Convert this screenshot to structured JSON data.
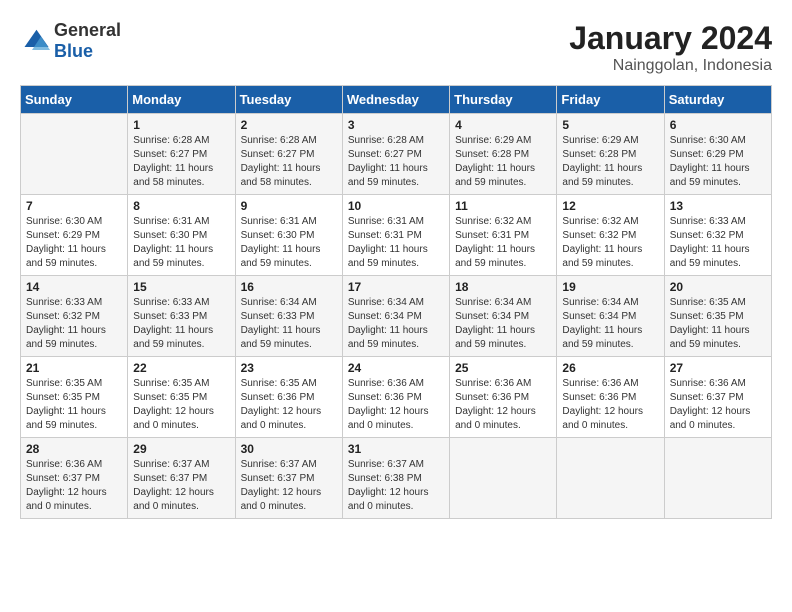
{
  "header": {
    "logo_general": "General",
    "logo_blue": "Blue",
    "month_year": "January 2024",
    "location": "Nainggolan, Indonesia"
  },
  "days_of_week": [
    "Sunday",
    "Monday",
    "Tuesday",
    "Wednesday",
    "Thursday",
    "Friday",
    "Saturday"
  ],
  "weeks": [
    [
      {
        "day": "",
        "sunrise": "",
        "sunset": "",
        "daylight": ""
      },
      {
        "day": "1",
        "sunrise": "6:28 AM",
        "sunset": "6:27 PM",
        "daylight": "11 hours and 58 minutes."
      },
      {
        "day": "2",
        "sunrise": "6:28 AM",
        "sunset": "6:27 PM",
        "daylight": "11 hours and 58 minutes."
      },
      {
        "day": "3",
        "sunrise": "6:28 AM",
        "sunset": "6:27 PM",
        "daylight": "11 hours and 59 minutes."
      },
      {
        "day": "4",
        "sunrise": "6:29 AM",
        "sunset": "6:28 PM",
        "daylight": "11 hours and 59 minutes."
      },
      {
        "day": "5",
        "sunrise": "6:29 AM",
        "sunset": "6:28 PM",
        "daylight": "11 hours and 59 minutes."
      },
      {
        "day": "6",
        "sunrise": "6:30 AM",
        "sunset": "6:29 PM",
        "daylight": "11 hours and 59 minutes."
      }
    ],
    [
      {
        "day": "7",
        "sunrise": "6:30 AM",
        "sunset": "6:29 PM",
        "daylight": "11 hours and 59 minutes."
      },
      {
        "day": "8",
        "sunrise": "6:31 AM",
        "sunset": "6:30 PM",
        "daylight": "11 hours and 59 minutes."
      },
      {
        "day": "9",
        "sunrise": "6:31 AM",
        "sunset": "6:30 PM",
        "daylight": "11 hours and 59 minutes."
      },
      {
        "day": "10",
        "sunrise": "6:31 AM",
        "sunset": "6:31 PM",
        "daylight": "11 hours and 59 minutes."
      },
      {
        "day": "11",
        "sunrise": "6:32 AM",
        "sunset": "6:31 PM",
        "daylight": "11 hours and 59 minutes."
      },
      {
        "day": "12",
        "sunrise": "6:32 AM",
        "sunset": "6:32 PM",
        "daylight": "11 hours and 59 minutes."
      },
      {
        "day": "13",
        "sunrise": "6:33 AM",
        "sunset": "6:32 PM",
        "daylight": "11 hours and 59 minutes."
      }
    ],
    [
      {
        "day": "14",
        "sunrise": "6:33 AM",
        "sunset": "6:32 PM",
        "daylight": "11 hours and 59 minutes."
      },
      {
        "day": "15",
        "sunrise": "6:33 AM",
        "sunset": "6:33 PM",
        "daylight": "11 hours and 59 minutes."
      },
      {
        "day": "16",
        "sunrise": "6:34 AM",
        "sunset": "6:33 PM",
        "daylight": "11 hours and 59 minutes."
      },
      {
        "day": "17",
        "sunrise": "6:34 AM",
        "sunset": "6:34 PM",
        "daylight": "11 hours and 59 minutes."
      },
      {
        "day": "18",
        "sunrise": "6:34 AM",
        "sunset": "6:34 PM",
        "daylight": "11 hours and 59 minutes."
      },
      {
        "day": "19",
        "sunrise": "6:34 AM",
        "sunset": "6:34 PM",
        "daylight": "11 hours and 59 minutes."
      },
      {
        "day": "20",
        "sunrise": "6:35 AM",
        "sunset": "6:35 PM",
        "daylight": "11 hours and 59 minutes."
      }
    ],
    [
      {
        "day": "21",
        "sunrise": "6:35 AM",
        "sunset": "6:35 PM",
        "daylight": "11 hours and 59 minutes."
      },
      {
        "day": "22",
        "sunrise": "6:35 AM",
        "sunset": "6:35 PM",
        "daylight": "12 hours and 0 minutes."
      },
      {
        "day": "23",
        "sunrise": "6:35 AM",
        "sunset": "6:36 PM",
        "daylight": "12 hours and 0 minutes."
      },
      {
        "day": "24",
        "sunrise": "6:36 AM",
        "sunset": "6:36 PM",
        "daylight": "12 hours and 0 minutes."
      },
      {
        "day": "25",
        "sunrise": "6:36 AM",
        "sunset": "6:36 PM",
        "daylight": "12 hours and 0 minutes."
      },
      {
        "day": "26",
        "sunrise": "6:36 AM",
        "sunset": "6:36 PM",
        "daylight": "12 hours and 0 minutes."
      },
      {
        "day": "27",
        "sunrise": "6:36 AM",
        "sunset": "6:37 PM",
        "daylight": "12 hours and 0 minutes."
      }
    ],
    [
      {
        "day": "28",
        "sunrise": "6:36 AM",
        "sunset": "6:37 PM",
        "daylight": "12 hours and 0 minutes."
      },
      {
        "day": "29",
        "sunrise": "6:37 AM",
        "sunset": "6:37 PM",
        "daylight": "12 hours and 0 minutes."
      },
      {
        "day": "30",
        "sunrise": "6:37 AM",
        "sunset": "6:37 PM",
        "daylight": "12 hours and 0 minutes."
      },
      {
        "day": "31",
        "sunrise": "6:37 AM",
        "sunset": "6:38 PM",
        "daylight": "12 hours and 0 minutes."
      },
      {
        "day": "",
        "sunrise": "",
        "sunset": "",
        "daylight": ""
      },
      {
        "day": "",
        "sunrise": "",
        "sunset": "",
        "daylight": ""
      },
      {
        "day": "",
        "sunrise": "",
        "sunset": "",
        "daylight": ""
      }
    ]
  ],
  "labels": {
    "sunrise_prefix": "Sunrise: ",
    "sunset_prefix": "Sunset: ",
    "daylight_prefix": "Daylight: "
  }
}
